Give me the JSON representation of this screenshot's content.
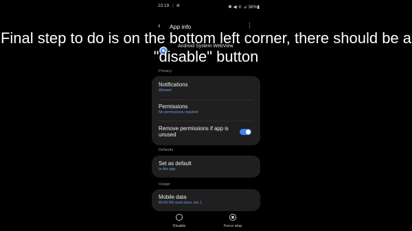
{
  "status_bar": {
    "time": "10:19",
    "left_icons": "⋮ ⚙",
    "right": "✱ ◀ ᯤ ⊿ 38%▮"
  },
  "header": {
    "title": "App info"
  },
  "app": {
    "name": "Android System WebView"
  },
  "sections": {
    "privacy": "Privacy",
    "defaults": "Defaults",
    "usage": "Usage"
  },
  "privacy_rows": {
    "notifications": {
      "title": "Notifications",
      "sub": "Allowed"
    },
    "permissions": {
      "title": "Permissions",
      "sub": "No permissions required"
    },
    "remove_permissions": {
      "title_line1": "Remove permissions if app is",
      "title_line2": "unused",
      "toggle_on": true
    }
  },
  "defaults_rows": {
    "set_as_default": {
      "title": "Set as default",
      "sub": "In this app"
    }
  },
  "usage_rows": {
    "mobile_data": {
      "title": "Mobile data",
      "sub": "60.63 KB used since Jan 1"
    }
  },
  "bottom_actions": {
    "disable": "Disable",
    "force_stop": "Force stop"
  },
  "overlay": {
    "caption": "Final step to do is on the bottom left corner, there should be a \"disable\" button"
  },
  "colors": {
    "background": "#000000",
    "card": "#1f1f1f",
    "accent": "#3e82f7",
    "subtext_blue": "#6f9eef"
  }
}
